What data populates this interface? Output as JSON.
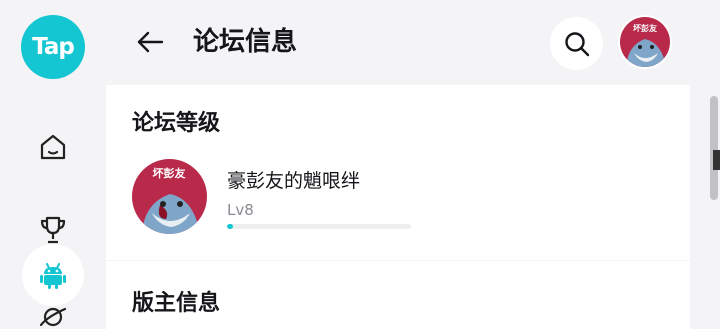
{
  "app": {
    "logo_text": "Tap",
    "accent_color": "#14c5d2"
  },
  "rail": {
    "items": [
      {
        "icon": "home-icon"
      },
      {
        "icon": "trophy-icon"
      },
      {
        "icon": "android-icon",
        "active": true
      },
      {
        "icon": "planet-icon"
      }
    ]
  },
  "header": {
    "title": "论坛信息",
    "back_icon": "back-arrow-icon",
    "search_icon": "search-icon"
  },
  "forum_level": {
    "section_title": "论坛等级",
    "user": {
      "name": "豪彭友的魈哏绊",
      "level": "Lv8",
      "progress": 0.03,
      "avatar_badge_text": "坏彭友"
    }
  },
  "moderator": {
    "section_title": "版主信息"
  }
}
